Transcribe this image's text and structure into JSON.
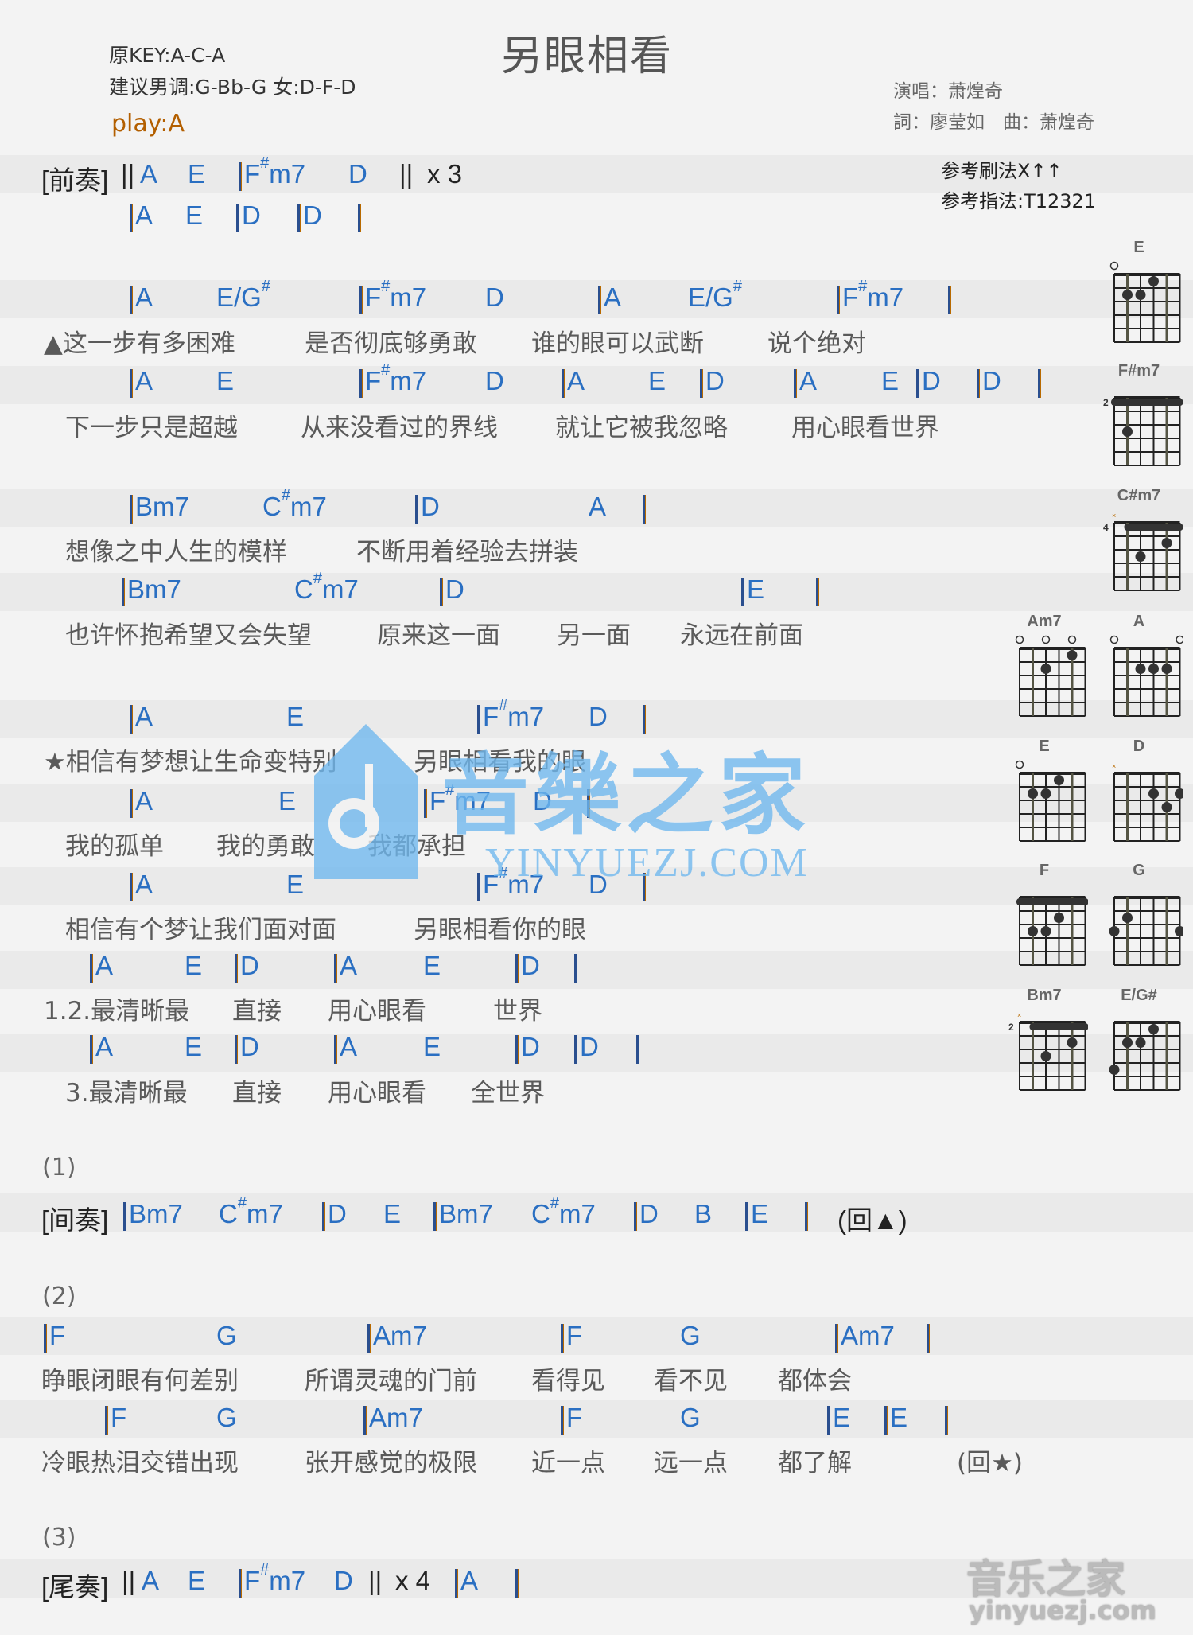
{
  "header": {
    "title": "另眼相看",
    "original_key": "原KEY:A-C-A",
    "suggested_key": "建议男调:G-Bb-G 女:D-F-D",
    "play_key": "play:A",
    "singer": "演唱：萧煌奇",
    "lyricist_composer": "詞：廖莹如　曲：萧煌奇",
    "strum_pattern": "参考刷法X↑↑",
    "finger_pattern": "参考指法:T12321"
  },
  "intro": {
    "label": "[前奏]",
    "line1": {
      "open": "||",
      "chords": [
        "A",
        "E",
        "|F#m7",
        "D"
      ],
      "close": "||",
      "repeat": "x 3"
    },
    "line2": {
      "chords": [
        "|A",
        "E",
        "|D",
        "|D",
        "|"
      ]
    }
  },
  "verse": [
    {
      "chords": [
        "|A",
        "E/G#",
        "|F#m7",
        "D",
        "|A",
        "E/G#",
        "|F#m7",
        "|"
      ],
      "lyrics": [
        "▲这一步有多困难",
        "是否彻底够勇敢",
        "谁的眼可以武断",
        "说个绝对"
      ]
    },
    {
      "chords": [
        "|A",
        "E",
        "|F#m7",
        "D",
        "|A",
        "E",
        "|D",
        "|A",
        "E",
        "|D",
        "|D",
        "|"
      ],
      "lyrics": [
        "下一步只是超越",
        "从来没看过的界线",
        "就让它被我忽略",
        "用心眼看世界"
      ]
    },
    {
      "chords": [
        "|Bm7",
        "C#m7",
        "|D",
        "A",
        "|"
      ],
      "lyrics": [
        "想像之中人生的模样",
        "不断用着经验去拼装"
      ]
    },
    {
      "chords": [
        "|Bm7",
        "C#m7",
        "|D",
        "|E",
        "|"
      ],
      "lyrics": [
        "也许怀抱希望又会失望",
        "原来这一面",
        "另一面",
        "永远在前面"
      ]
    }
  ],
  "chorus": [
    {
      "chords": [
        "|A",
        "E",
        "|F#m7",
        "D",
        "|"
      ],
      "lyrics": [
        "★相信有梦想让生命变特别",
        "另眼相看我的眼"
      ]
    },
    {
      "chords": [
        "|A",
        "E",
        "|F#m7",
        "D",
        "|"
      ],
      "lyrics": [
        "我的孤单",
        "我的勇敢",
        "我都承担"
      ]
    },
    {
      "chords": [
        "|A",
        "E",
        "|F#m7",
        "D",
        "|"
      ],
      "lyrics": [
        "相信有个梦让我们面对面",
        "另眼相看你的眼"
      ]
    },
    {
      "chords": [
        "|A",
        "E",
        "|D",
        "|A",
        "E",
        "|D",
        "|"
      ],
      "lyrics": [
        "1.2.最清晰最",
        "直接",
        "用心眼看",
        "世界"
      ]
    },
    {
      "chords": [
        "|A",
        "E",
        "|D",
        "|A",
        "E",
        "|D",
        "|D",
        "|"
      ],
      "lyrics": [
        "3.最清晰最",
        "直接",
        "用心眼看",
        "全世界"
      ]
    }
  ],
  "section1": {
    "number": "(1)",
    "label": "[间奏]",
    "chords": [
      "|Bm7",
      "C#m7",
      "|D",
      "E",
      "|Bm7",
      "C#m7",
      "|D",
      "B",
      "|E",
      "|"
    ],
    "return": "(回▲)"
  },
  "section2": {
    "number": "(2)",
    "lines": [
      {
        "chords": [
          "|F",
          "G",
          "|Am7",
          "|F",
          "G",
          "|Am7",
          "|"
        ],
        "lyrics": [
          "睁眼闭眼有何差别",
          "所谓灵魂的门前",
          "看得见",
          "看不见",
          "都体会"
        ]
      },
      {
        "chords": [
          "|F",
          "G",
          "|Am7",
          "|F",
          "G",
          "|E",
          "|E",
          "|"
        ],
        "lyrics": [
          "冷眼热泪交错出现",
          "张开感觉的极限",
          "近一点",
          "远一点",
          "都了解"
        ],
        "return": "(回★)"
      }
    ]
  },
  "section3": {
    "number": "(3)",
    "label": "[尾奏]",
    "open": "||",
    "chords": [
      "A",
      "E",
      "|F#m7",
      "D"
    ],
    "close": "||",
    "repeat": "x 4",
    "tail": [
      "|A",
      "|"
    ]
  },
  "chord_diagrams": [
    {
      "name": "E",
      "base_fret": "",
      "open": [
        1
      ],
      "muted": [],
      "dots": [
        [
          2,
          2
        ],
        [
          3,
          2
        ],
        [
          4,
          1
        ]
      ],
      "barre": null
    },
    {
      "name": "F#m7",
      "base_fret": "2",
      "open": [],
      "muted": [],
      "dots": [
        [
          2,
          3
        ]
      ],
      "barre": [
        1,
        6
      ]
    },
    {
      "name": "C#m7",
      "base_fret": "4",
      "open": [],
      "muted": [
        1
      ],
      "dots": [
        [
          3,
          3
        ],
        [
          5,
          2
        ]
      ],
      "barre": [
        2,
        6
      ]
    },
    {
      "name": "Am7",
      "base_fret": "",
      "open": [
        1,
        3,
        5
      ],
      "muted": [],
      "dots": [
        [
          3,
          2
        ],
        [
          5,
          1
        ]
      ],
      "barre": null
    },
    {
      "name": "A",
      "base_fret": "",
      "open": [
        1,
        6
      ],
      "muted": [],
      "dots": [
        [
          3,
          2
        ],
        [
          4,
          2
        ],
        [
          5,
          2
        ]
      ],
      "barre": null
    },
    {
      "name": "E",
      "base_fret": "",
      "open": [
        1
      ],
      "muted": [],
      "dots": [
        [
          2,
          2
        ],
        [
          3,
          2
        ],
        [
          4,
          1
        ]
      ],
      "barre": null
    },
    {
      "name": "D",
      "base_fret": "",
      "open": [],
      "muted": [
        1
      ],
      "dots": [
        [
          4,
          2
        ],
        [
          5,
          3
        ],
        [
          6,
          2
        ]
      ],
      "barre": null
    },
    {
      "name": "F",
      "base_fret": "",
      "open": [],
      "muted": [],
      "dots": [
        [
          2,
          3
        ],
        [
          3,
          3
        ],
        [
          4,
          2
        ]
      ],
      "barre": [
        1,
        6
      ]
    },
    {
      "name": "G",
      "base_fret": "",
      "open": [],
      "muted": [],
      "dots": [
        [
          1,
          3
        ],
        [
          2,
          2
        ],
        [
          6,
          3
        ]
      ],
      "barre": null
    },
    {
      "name": "Bm7",
      "base_fret": "2",
      "open": [],
      "muted": [
        1
      ],
      "dots": [
        [
          3,
          3
        ],
        [
          5,
          2
        ]
      ],
      "barre": [
        2,
        6
      ]
    },
    {
      "name": "E/G#",
      "base_fret": "",
      "open": [],
      "muted": [],
      "dots": [
        [
          1,
          4
        ],
        [
          2,
          2
        ],
        [
          3,
          2
        ],
        [
          4,
          1
        ]
      ],
      "barre": null
    }
  ],
  "watermark": {
    "main": "音樂之家",
    "url": "YINYUEZJ.COM",
    "corner_main": "音乐之家",
    "corner_url": "yinyuezj.com"
  }
}
